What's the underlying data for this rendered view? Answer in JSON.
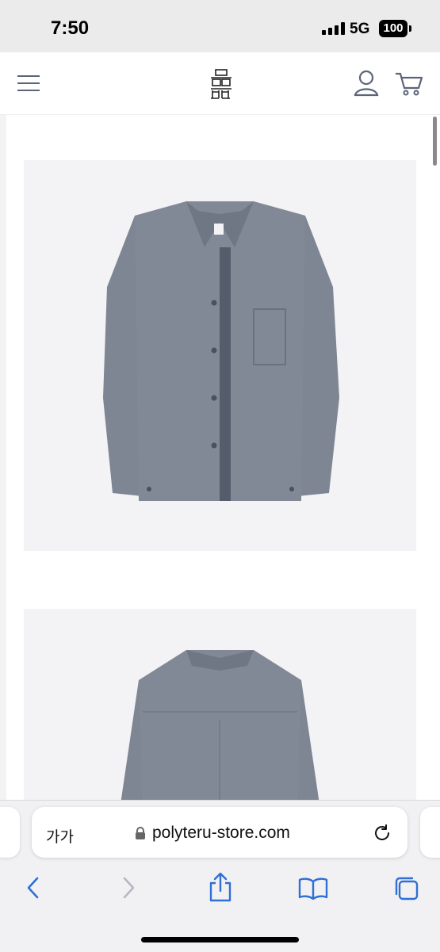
{
  "status_bar": {
    "time": "7:50",
    "network": "5G",
    "battery": "100"
  },
  "header": {
    "menu_icon": "hamburger-menu-icon",
    "logo_name": "polyteru-logo",
    "account_icon": "user-icon",
    "cart_icon": "cart-icon"
  },
  "products": {
    "images": [
      {
        "subject": "grey button-up shirt front view"
      },
      {
        "subject": "grey button-up shirt back view"
      }
    ]
  },
  "browser": {
    "text_size_label": "가가",
    "url": "polyteru-store.com",
    "toolbar": [
      "back-icon",
      "forward-icon",
      "share-icon",
      "bookmarks-icon",
      "tabs-icon"
    ]
  },
  "colors": {
    "accent": "#3a7bd5",
    "shirt": "#7e8593",
    "image_bg": "#f3f3f5"
  }
}
